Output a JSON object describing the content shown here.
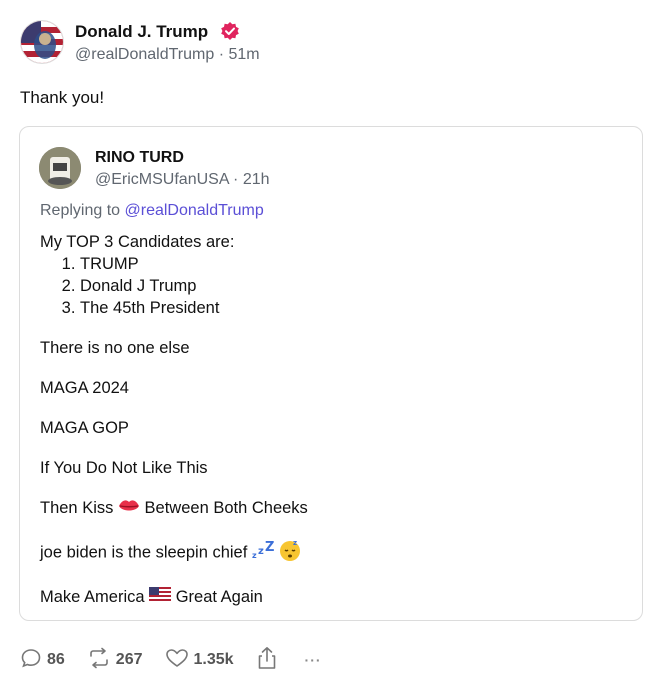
{
  "post": {
    "author_name": "Donald J. Trump",
    "handle_time": "@realDonaldTrump · 51m",
    "text": "Thank you!",
    "verified_icon": "verified-badge-icon",
    "accent_color": "#e0245e"
  },
  "quote": {
    "author_name": "RINO TURD",
    "handle_time": "@EricMSUfanUSA · 21h",
    "replying_prefix": "Replying to ",
    "replying_handle": "@realDonaldTrump",
    "intro": "My TOP 3 Candidates are:",
    "list": [
      "TRUMP",
      "Donald J Trump",
      "The 45th President"
    ],
    "line1": "There is no one else",
    "line2": "MAGA 2024",
    "line3": "MAGA GOP",
    "line4": "If You Do Not Like This",
    "line5_a": "Then Kiss ",
    "line5_b": " Between Both Cheeks",
    "line6": "joe biden is the sleepin chief ",
    "line7_a": "Make America ",
    "line7_b": " Great Again",
    "link_color": "#5b4fd6"
  },
  "actions": {
    "replies": "86",
    "reposts": "267",
    "likes": "1.35k",
    "more": "···"
  }
}
